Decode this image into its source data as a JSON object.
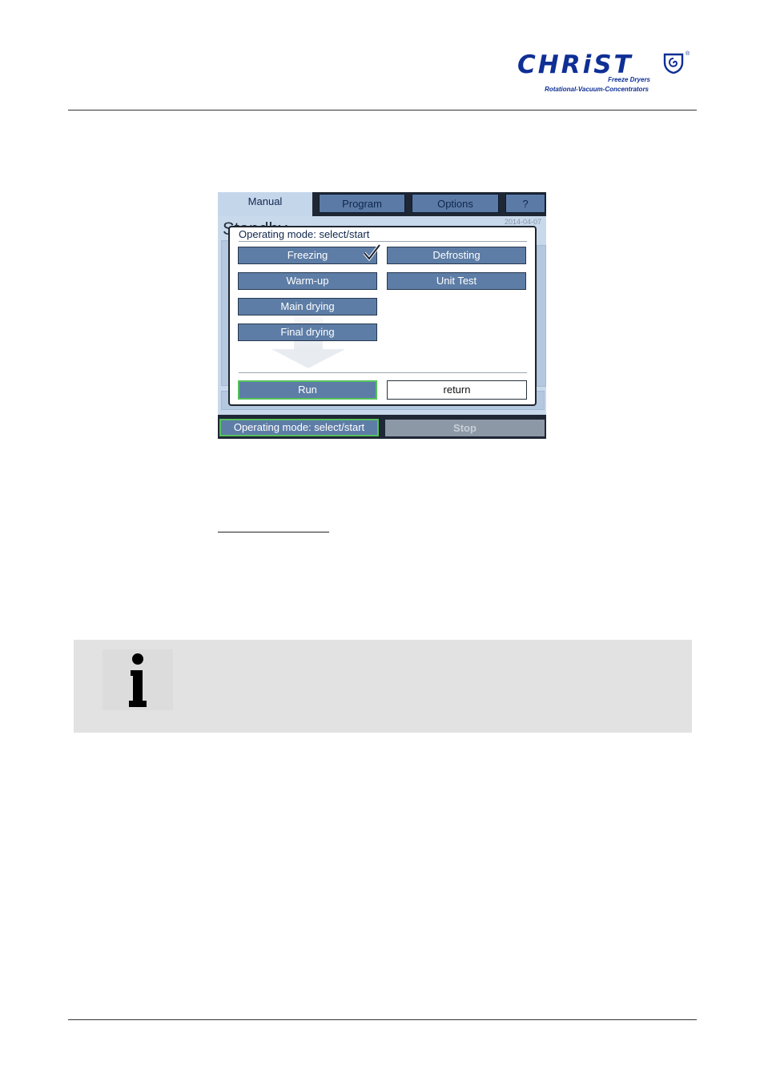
{
  "header": {
    "brand": "CHRiST",
    "tagline_1": "Freeze Dryers",
    "tagline_2": "Rotational-Vacuum-Concentrators",
    "reg_mark": "®",
    "brand_color": "#0f2f95"
  },
  "screen": {
    "tabs": [
      {
        "label": "Manual",
        "active": true
      },
      {
        "label": "Program",
        "active": false
      },
      {
        "label": "Options",
        "active": false
      },
      {
        "label": "?",
        "active": false
      }
    ],
    "background_status": "Standby",
    "background_date": "2014-04-07",
    "dialog": {
      "title": "Operating mode: select/start",
      "modes_left": [
        "Freezing",
        "Warm-up",
        "Main drying",
        "Final drying"
      ],
      "modes_right": [
        "Defrosting",
        "Unit Test"
      ],
      "selected_mode": "Freezing",
      "run_label": "Run",
      "return_label": "return"
    },
    "status_bar": {
      "mode_label": "Operating mode: select/start",
      "stop_label": "Stop"
    },
    "colors": {
      "button": "#5d7da6",
      "active_tab": "#c4d6ea",
      "highlight": "#56c15e",
      "frame": "#1e2733"
    }
  },
  "info_box": {
    "icon": "info-icon",
    "glyph": "i"
  }
}
